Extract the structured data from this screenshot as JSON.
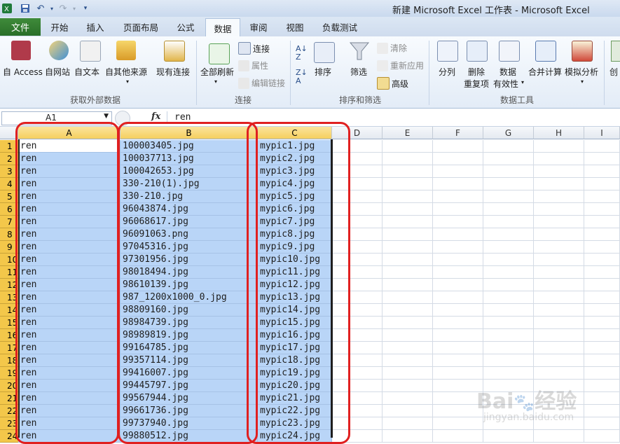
{
  "window": {
    "title": "新建 Microsoft Excel 工作表 - Microsoft Excel"
  },
  "quick_access": {
    "save_icon": "save-icon",
    "undo_icon": "undo-icon",
    "redo_icon": "redo-icon",
    "customize_icon": "chevron-down-icon"
  },
  "tabs": {
    "file": "文件",
    "items": [
      "开始",
      "插入",
      "页面布局",
      "公式",
      "数据",
      "审阅",
      "视图",
      "负载测试"
    ],
    "active": "数据"
  },
  "ribbon": {
    "get_external": {
      "label": "获取外部数据",
      "access": "自 Access",
      "web": "自网站",
      "text": "自文本",
      "other": "自其他来源",
      "existing": "现有连接"
    },
    "connections": {
      "label": "连接",
      "refresh_all": "全部刷新",
      "connections": "连接",
      "properties": "属性",
      "edit_links": "编辑链接"
    },
    "sort_filter": {
      "label": "排序和筛选",
      "sort": "排序",
      "filter": "筛选",
      "clear": "清除",
      "reapply": "重新应用",
      "advanced": "高级"
    },
    "data_tools": {
      "label": "数据工具",
      "split": "分列",
      "remove_dup_1": "删除",
      "remove_dup_2": "重复项",
      "validation_1": "数据",
      "validation_2": "有效性",
      "consolidate": "合并计算",
      "whatif": "模拟分析",
      "create_partial": "创"
    }
  },
  "formula_bar": {
    "name_box": "A1",
    "fx": "fx",
    "formula": "ren"
  },
  "sheet": {
    "columns": [
      "A",
      "B",
      "C",
      "D",
      "E",
      "F",
      "G",
      "H",
      "I"
    ],
    "rows": [
      {
        "n": "1",
        "a": "ren",
        "b": "100003405.jpg",
        "c": "mypic1.jpg"
      },
      {
        "n": "2",
        "a": "ren",
        "b": "100037713.jpg",
        "c": "mypic2.jpg"
      },
      {
        "n": "3",
        "a": "ren",
        "b": "100042653.jpg",
        "c": "mypic3.jpg"
      },
      {
        "n": "4",
        "a": "ren",
        "b": "330-210(1).jpg",
        "c": "mypic4.jpg"
      },
      {
        "n": "5",
        "a": "ren",
        "b": "330-210.jpg",
        "c": "mypic5.jpg"
      },
      {
        "n": "6",
        "a": "ren",
        "b": "96043874.jpg",
        "c": "mypic6.jpg"
      },
      {
        "n": "7",
        "a": "ren",
        "b": "96068617.jpg",
        "c": "mypic7.jpg"
      },
      {
        "n": "8",
        "a": "ren",
        "b": "96091063.png",
        "c": "mypic8.jpg"
      },
      {
        "n": "9",
        "a": "ren",
        "b": "97045316.jpg",
        "c": "mypic9.jpg"
      },
      {
        "n": "10",
        "a": "ren",
        "b": "97301956.jpg",
        "c": "mypic10.jpg"
      },
      {
        "n": "11",
        "a": "ren",
        "b": "98018494.jpg",
        "c": "mypic11.jpg"
      },
      {
        "n": "12",
        "a": "ren",
        "b": "98610139.jpg",
        "c": "mypic12.jpg"
      },
      {
        "n": "13",
        "a": "ren",
        "b": "987_1200x1000_0.jpg",
        "c": "mypic13.jpg"
      },
      {
        "n": "14",
        "a": "ren",
        "b": "98809160.jpg",
        "c": "mypic14.jpg"
      },
      {
        "n": "15",
        "a": "ren",
        "b": "98984739.jpg",
        "c": "mypic15.jpg"
      },
      {
        "n": "16",
        "a": "ren",
        "b": "98989819.jpg",
        "c": "mypic16.jpg"
      },
      {
        "n": "17",
        "a": "ren",
        "b": "99164785.jpg",
        "c": "mypic17.jpg"
      },
      {
        "n": "18",
        "a": "ren",
        "b": "99357114.jpg",
        "c": "mypic18.jpg"
      },
      {
        "n": "19",
        "a": "ren",
        "b": "99416007.jpg",
        "c": "mypic19.jpg"
      },
      {
        "n": "20",
        "a": "ren",
        "b": "99445797.jpg",
        "c": "mypic20.jpg"
      },
      {
        "n": "21",
        "a": "ren",
        "b": "99567944.jpg",
        "c": "mypic21.jpg"
      },
      {
        "n": "22",
        "a": "ren",
        "b": "99661736.jpg",
        "c": "mypic22.jpg"
      },
      {
        "n": "23",
        "a": "ren",
        "b": "99737940.jpg",
        "c": "mypic23.jpg"
      },
      {
        "n": "24",
        "a": "ren",
        "b": "99880512.jpg",
        "c": "mypic24.jpg"
      }
    ]
  },
  "watermark": {
    "brand": "Bai",
    "brand_suffix": "经验",
    "url": "jingyan.baidu.com"
  },
  "colors": {
    "file_tab": "#2a6f29",
    "selection": "#b9d5f7",
    "header_selected": "#f5cf5f",
    "annotation": "#e02020"
  }
}
